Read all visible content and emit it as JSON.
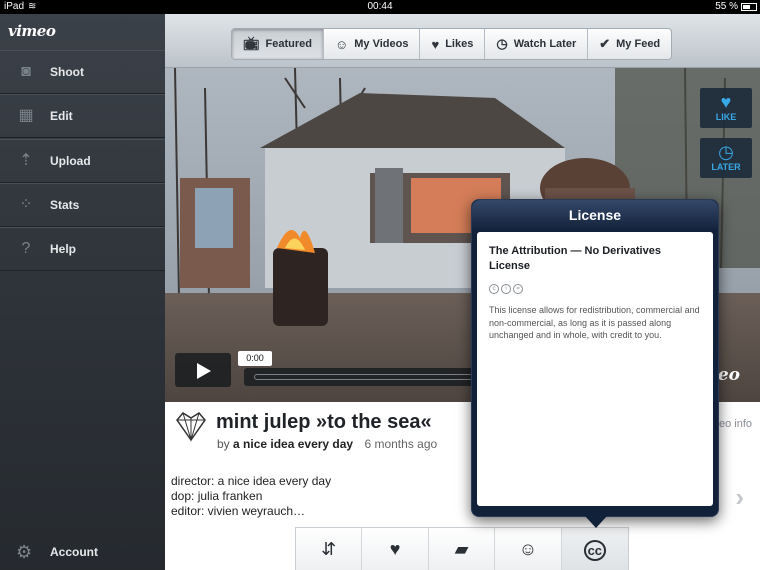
{
  "statusbar": {
    "device": "iPad",
    "time": "00:44",
    "battery": "55 %"
  },
  "sidebar": {
    "logo": "vimeo",
    "items": [
      {
        "label": "Shoot",
        "icon": "camera-icon"
      },
      {
        "label": "Edit",
        "icon": "clapperboard-icon"
      },
      {
        "label": "Upload",
        "icon": "upload-icon"
      },
      {
        "label": "Stats",
        "icon": "stats-icon"
      },
      {
        "label": "Help",
        "icon": "help-icon"
      }
    ],
    "account": "Account"
  },
  "tabs": [
    {
      "label": "Featured",
      "icon": "tv-icon",
      "active": true
    },
    {
      "label": "My Videos",
      "icon": "smiley-icon"
    },
    {
      "label": "Likes",
      "icon": "heart-icon"
    },
    {
      "label": "Watch Later",
      "icon": "clock-icon"
    },
    {
      "label": "My Feed",
      "icon": "checkmark-icon"
    }
  ],
  "player": {
    "time": "0:00",
    "watermark": "vimeo",
    "like_label": "LIKE",
    "later_label": "LATER"
  },
  "video": {
    "title": "mint julep »to the sea«",
    "by": "by",
    "author": "a nice idea every day",
    "ago": "6 months ago",
    "credits": [
      "director: a nice idea every day",
      "dop: julia franken",
      "editor: vivien weyrauch…"
    ],
    "info_link": "eo info"
  },
  "license": {
    "header": "License",
    "title": "The Attribution — No Derivatives License",
    "description": "This license allows for redistribution, commercial and non-commercial, as long as it is passed along unchanged and in whole, with credit to you."
  },
  "actions": [
    "share-icon",
    "heart-icon",
    "comment-icon",
    "smiley-icon",
    "cc-icon"
  ],
  "colors": {
    "accent": "#38a8e6",
    "popover": "#12213a",
    "sidebar": "#2c3137"
  }
}
